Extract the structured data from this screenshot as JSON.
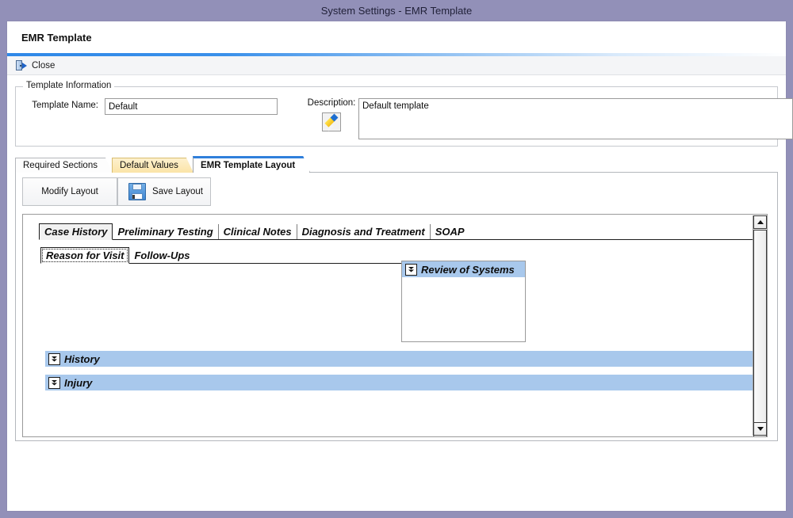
{
  "window": {
    "title": "System Settings - EMR Template",
    "header_title": "EMR Template"
  },
  "toolbar": {
    "close_label": "Close",
    "close_icon": "exit-door-icon"
  },
  "template_information": {
    "legend": "Template Information",
    "template_name_label": "Template Name:",
    "template_name_value": "Default",
    "template_name_placeholder": "",
    "description_label": "Description:",
    "description_value": "Default template",
    "description_placeholder": "",
    "edit_icon": "pencil-icon"
  },
  "tabs": [
    {
      "label": "Required Sections",
      "style": "white",
      "active": false
    },
    {
      "label": "Default Values",
      "style": "tan",
      "active": false
    },
    {
      "label": "EMR Template Layout",
      "style": "active",
      "active": true
    }
  ],
  "layout_toolbar": {
    "modify_label": "Modify Layout",
    "save_label": "Save Layout",
    "save_icon": "floppy-disk-icon"
  },
  "designer": {
    "inner_tabs": [
      {
        "label": "Case History",
        "selected": true
      },
      {
        "label": "Preliminary Testing",
        "selected": false
      },
      {
        "label": "Clinical Notes",
        "selected": false
      },
      {
        "label": "Diagnosis and Treatment",
        "selected": false
      },
      {
        "label": "SOAP",
        "selected": false
      }
    ],
    "sub_tabs": [
      {
        "label": "Reason for Visit",
        "selected": true
      },
      {
        "label": "Follow-Ups",
        "selected": false
      }
    ],
    "review_of_systems": {
      "title": "Review of Systems",
      "collapse_icon": "double-chevron-down-icon"
    },
    "sections": [
      {
        "title": "History",
        "collapse_icon": "double-chevron-down-icon"
      },
      {
        "title": "Injury",
        "collapse_icon": "double-chevron-down-icon"
      }
    ]
  },
  "colors": {
    "title_bar": "#9290b8",
    "accent_line": "#2f7fdb",
    "section_bar": "#a8c8ec",
    "active_tab_border": "#2f7fdb",
    "tan_tab": "#fbe4a8"
  }
}
